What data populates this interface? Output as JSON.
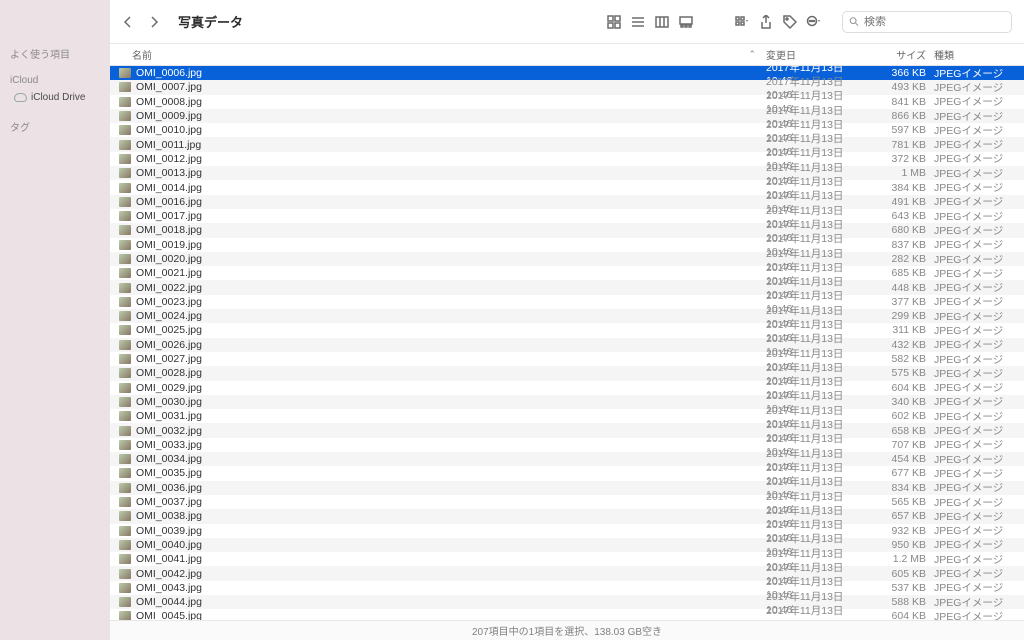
{
  "sidebar": {
    "favorites_label": "よく使う項目",
    "icloud_label": "iCloud",
    "icloud_drive": "iCloud Drive",
    "tags_label": "タグ"
  },
  "toolbar": {
    "title": "写真データ",
    "search_placeholder": "検索"
  },
  "headers": {
    "name": "名前",
    "date": "変更日",
    "size": "サイズ",
    "kind": "種類"
  },
  "common": {
    "date": "2017年11月13日 10:46",
    "kind": "JPEGイメージ"
  },
  "files": [
    {
      "n": "OMI_0006.jpg",
      "s": "366 KB",
      "sel": true
    },
    {
      "n": "OMI_0007.jpg",
      "s": "493 KB"
    },
    {
      "n": "OMI_0008.jpg",
      "s": "841 KB"
    },
    {
      "n": "OMI_0009.jpg",
      "s": "866 KB"
    },
    {
      "n": "OMI_0010.jpg",
      "s": "597 KB"
    },
    {
      "n": "OMI_0011.jpg",
      "s": "781 KB"
    },
    {
      "n": "OMI_0012.jpg",
      "s": "372 KB"
    },
    {
      "n": "OMI_0013.jpg",
      "s": "1 MB"
    },
    {
      "n": "OMI_0014.jpg",
      "s": "384 KB"
    },
    {
      "n": "OMI_0016.jpg",
      "s": "491 KB"
    },
    {
      "n": "OMI_0017.jpg",
      "s": "643 KB"
    },
    {
      "n": "OMI_0018.jpg",
      "s": "680 KB"
    },
    {
      "n": "OMI_0019.jpg",
      "s": "837 KB"
    },
    {
      "n": "OMI_0020.jpg",
      "s": "282 KB"
    },
    {
      "n": "OMI_0021.jpg",
      "s": "685 KB"
    },
    {
      "n": "OMI_0022.jpg",
      "s": "448 KB"
    },
    {
      "n": "OMI_0023.jpg",
      "s": "377 KB"
    },
    {
      "n": "OMI_0024.jpg",
      "s": "299 KB"
    },
    {
      "n": "OMI_0025.jpg",
      "s": "311 KB"
    },
    {
      "n": "OMI_0026.jpg",
      "s": "432 KB"
    },
    {
      "n": "OMI_0027.jpg",
      "s": "582 KB"
    },
    {
      "n": "OMI_0028.jpg",
      "s": "575 KB"
    },
    {
      "n": "OMI_0029.jpg",
      "s": "604 KB"
    },
    {
      "n": "OMI_0030.jpg",
      "s": "340 KB"
    },
    {
      "n": "OMI_0031.jpg",
      "s": "602 KB"
    },
    {
      "n": "OMI_0032.jpg",
      "s": "658 KB"
    },
    {
      "n": "OMI_0033.jpg",
      "s": "707 KB"
    },
    {
      "n": "OMI_0034.jpg",
      "s": "454 KB"
    },
    {
      "n": "OMI_0035.jpg",
      "s": "677 KB"
    },
    {
      "n": "OMI_0036.jpg",
      "s": "834 KB"
    },
    {
      "n": "OMI_0037.jpg",
      "s": "565 KB"
    },
    {
      "n": "OMI_0038.jpg",
      "s": "657 KB"
    },
    {
      "n": "OMI_0039.jpg",
      "s": "932 KB"
    },
    {
      "n": "OMI_0040.jpg",
      "s": "950 KB"
    },
    {
      "n": "OMI_0041.jpg",
      "s": "1.2 MB"
    },
    {
      "n": "OMI_0042.jpg",
      "s": "605 KB"
    },
    {
      "n": "OMI_0043.jpg",
      "s": "537 KB"
    },
    {
      "n": "OMI_0044.jpg",
      "s": "588 KB"
    },
    {
      "n": "OMI_0045.jpg",
      "s": "604 KB"
    }
  ],
  "status": "207項目中の1項目を選択、138.03 GB空き"
}
